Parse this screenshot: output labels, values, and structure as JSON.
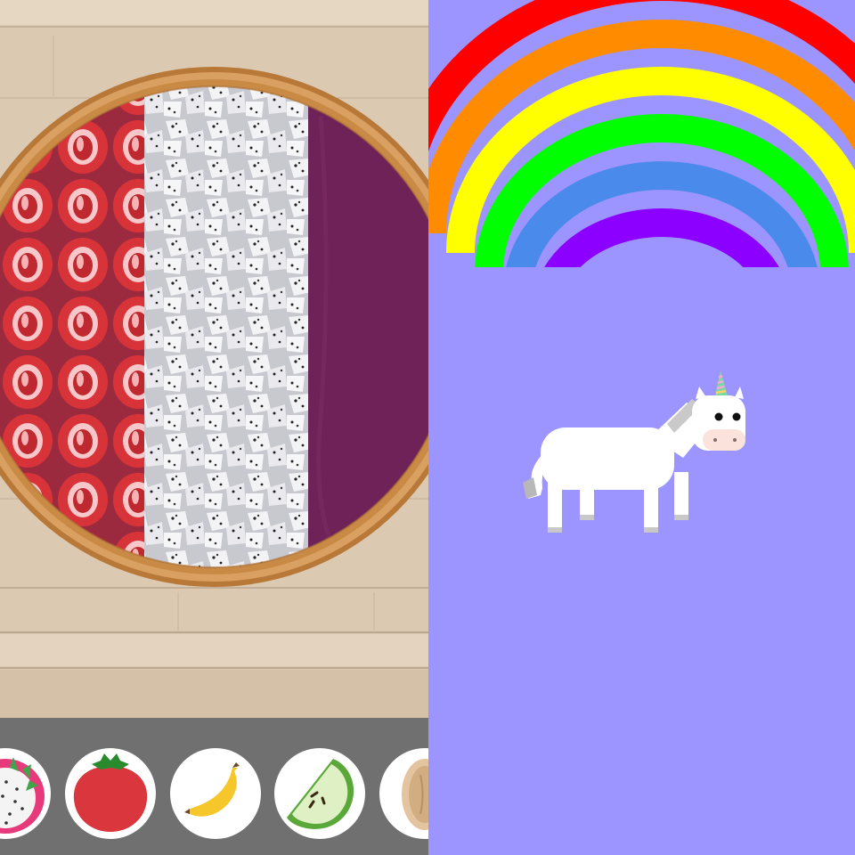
{
  "app": {
    "scene_left": "smoothie-bowl-builder",
    "scene_right": "unicorn-rainbow-scene"
  },
  "bowl": {
    "contents": [
      "strawberry-slices",
      "dragon-fruit-chunks",
      "acai-puree"
    ],
    "colors": {
      "bowl_rim": "#c98a45",
      "strawberry": "#d6323c",
      "dragon_fruit": "#f1f1f4",
      "acai": "#6e2258",
      "table_wood": "#dcc9b2"
    }
  },
  "toppings": [
    {
      "id": "dragon-fruit",
      "icon": "dragon-fruit-icon"
    },
    {
      "id": "strawberry",
      "icon": "strawberry-icon"
    },
    {
      "id": "banana",
      "icon": "banana-icon"
    },
    {
      "id": "apple",
      "icon": "apple-slice-icon"
    },
    {
      "id": "almond",
      "icon": "almond-icon"
    }
  ],
  "scene": {
    "background": "#9d95ff",
    "rainbow_colors": [
      "#ff0000",
      "#ff8c00",
      "#ffff00",
      "#00ff00",
      "#4a8aeb",
      "#8b00ff"
    ],
    "character": "unicorn"
  }
}
